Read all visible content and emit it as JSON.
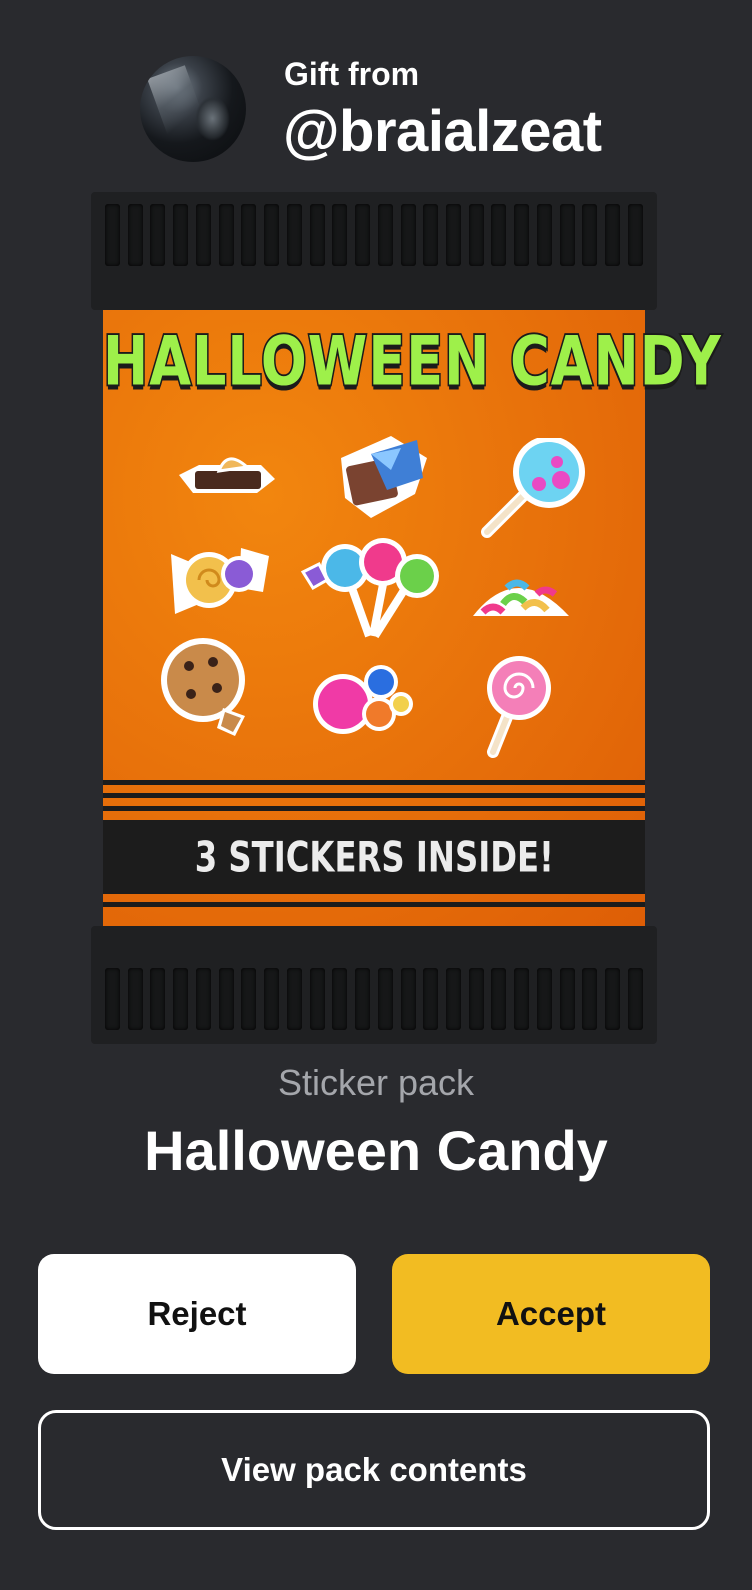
{
  "gift": {
    "from_label": "Gift from",
    "sender": "@braialzeat"
  },
  "pack": {
    "artwork_title": "HALLOWEEN CANDY",
    "artwork_banner": "3 STICKERS INSIDE!",
    "kind": "Sticker pack",
    "name": "Halloween Candy",
    "stickers": [
      "chocolate-bar",
      "chocolate-wrapper",
      "blue-lollipop",
      "wrapped-candies",
      "lollipop-bunch",
      "gummy-worms",
      "cookie",
      "gumballs",
      "swirl-lollipop"
    ]
  },
  "actions": {
    "reject": "Reject",
    "accept": "Accept",
    "view": "View pack contents"
  },
  "colors": {
    "background": "#292a2e",
    "accent": "#f2bc22",
    "pack_orange": "#e8720b"
  }
}
